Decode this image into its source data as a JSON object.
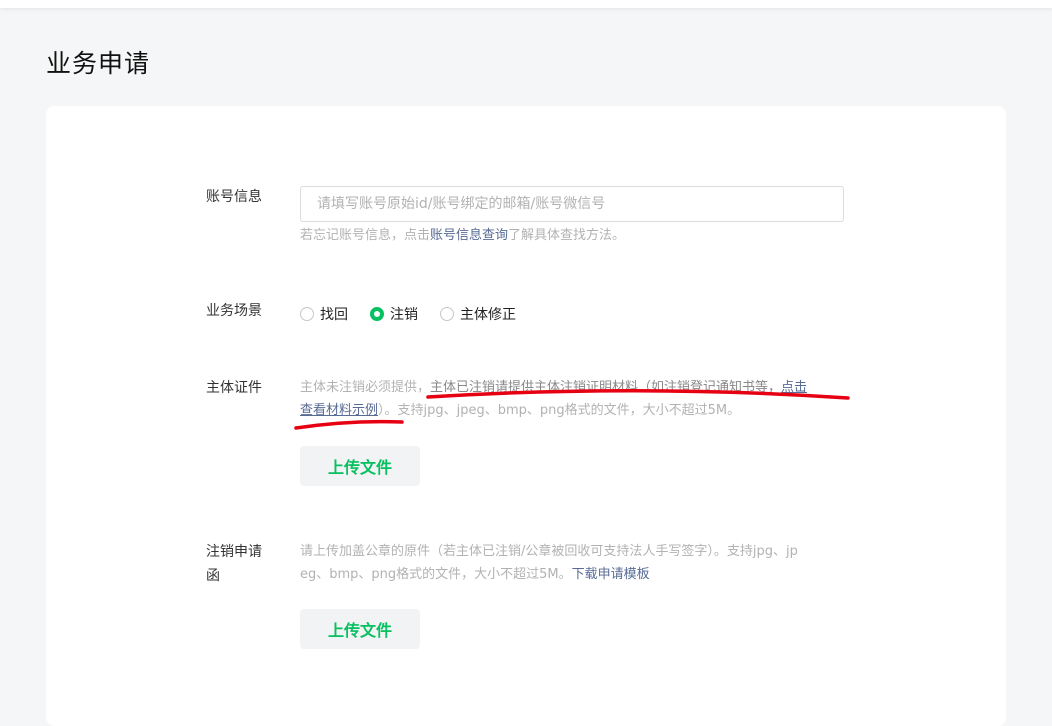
{
  "page": {
    "title": "业务申请"
  },
  "account": {
    "label": "账号信息",
    "placeholder": "请填写账号原始id/账号绑定的邮箱/账号微信号",
    "hint_prefix": "若忘记账号信息，点击",
    "hint_link": "账号信息查询",
    "hint_suffix": "了解具体查找方法。"
  },
  "scenario": {
    "label": "业务场景",
    "options": [
      "找回",
      "注销",
      "主体修正"
    ],
    "selected": "注销"
  },
  "certificate": {
    "label": "主体证件",
    "hint_line1_a": "主体未注销必须提供，",
    "hint_line1_b": "主体已注销请提供主体注销证明材料（如注销登记通知书等，",
    "hint_link_1": "点击",
    "hint_link_2": "查看材料示例",
    "hint_line2_rest": "）。支持jpg、jpeg、bmp、png格式的文件，大小不超过5M。",
    "upload_label": "上传文件"
  },
  "letter": {
    "label_line1": "注销申请",
    "label_line2": "函",
    "hint_line1": "请上传加盖公章的原件（若主体已注销/公章被回收可支持法人手写签字）。支持jpg、jp",
    "hint_line2": "eg、bmp、png格式的文件，大小不超过5M。",
    "hint_link": "下载申请模板",
    "upload_label": "上传文件"
  },
  "colors": {
    "accent": "#07c160",
    "link": "#576b95",
    "annotation": "#e60012"
  }
}
